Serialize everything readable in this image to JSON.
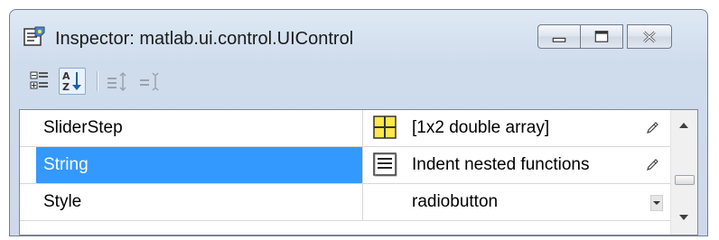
{
  "window": {
    "title": "Inspector:  matlab.ui.control.UIControl",
    "buttons": [
      "minimize",
      "maximize",
      "close"
    ]
  },
  "toolbar": {
    "buttons": [
      {
        "name": "categorize-icon",
        "active": false
      },
      {
        "name": "sort-alphabetically-icon",
        "active": true
      },
      {
        "name": "expand-all-icon",
        "active": false
      },
      {
        "name": "collapse-all-icon",
        "active": false
      }
    ]
  },
  "properties": [
    {
      "name": "SliderStep",
      "value": "[1x2  double array]",
      "editor_icon": "array-editor-icon",
      "control": "pencil-icon",
      "selected": false
    },
    {
      "name": "String",
      "value": "Indent nested functions",
      "editor_icon": "text-editor-icon",
      "control": "pencil-icon",
      "selected": true
    },
    {
      "name": "Style",
      "value": "radiobutton",
      "editor_icon": "",
      "control": "dropdown-arrow",
      "selected": false
    }
  ],
  "colors": {
    "selection": "#3399ff",
    "array_icon_fill": "#ffe84d",
    "window_frame": "#cfdcec"
  }
}
